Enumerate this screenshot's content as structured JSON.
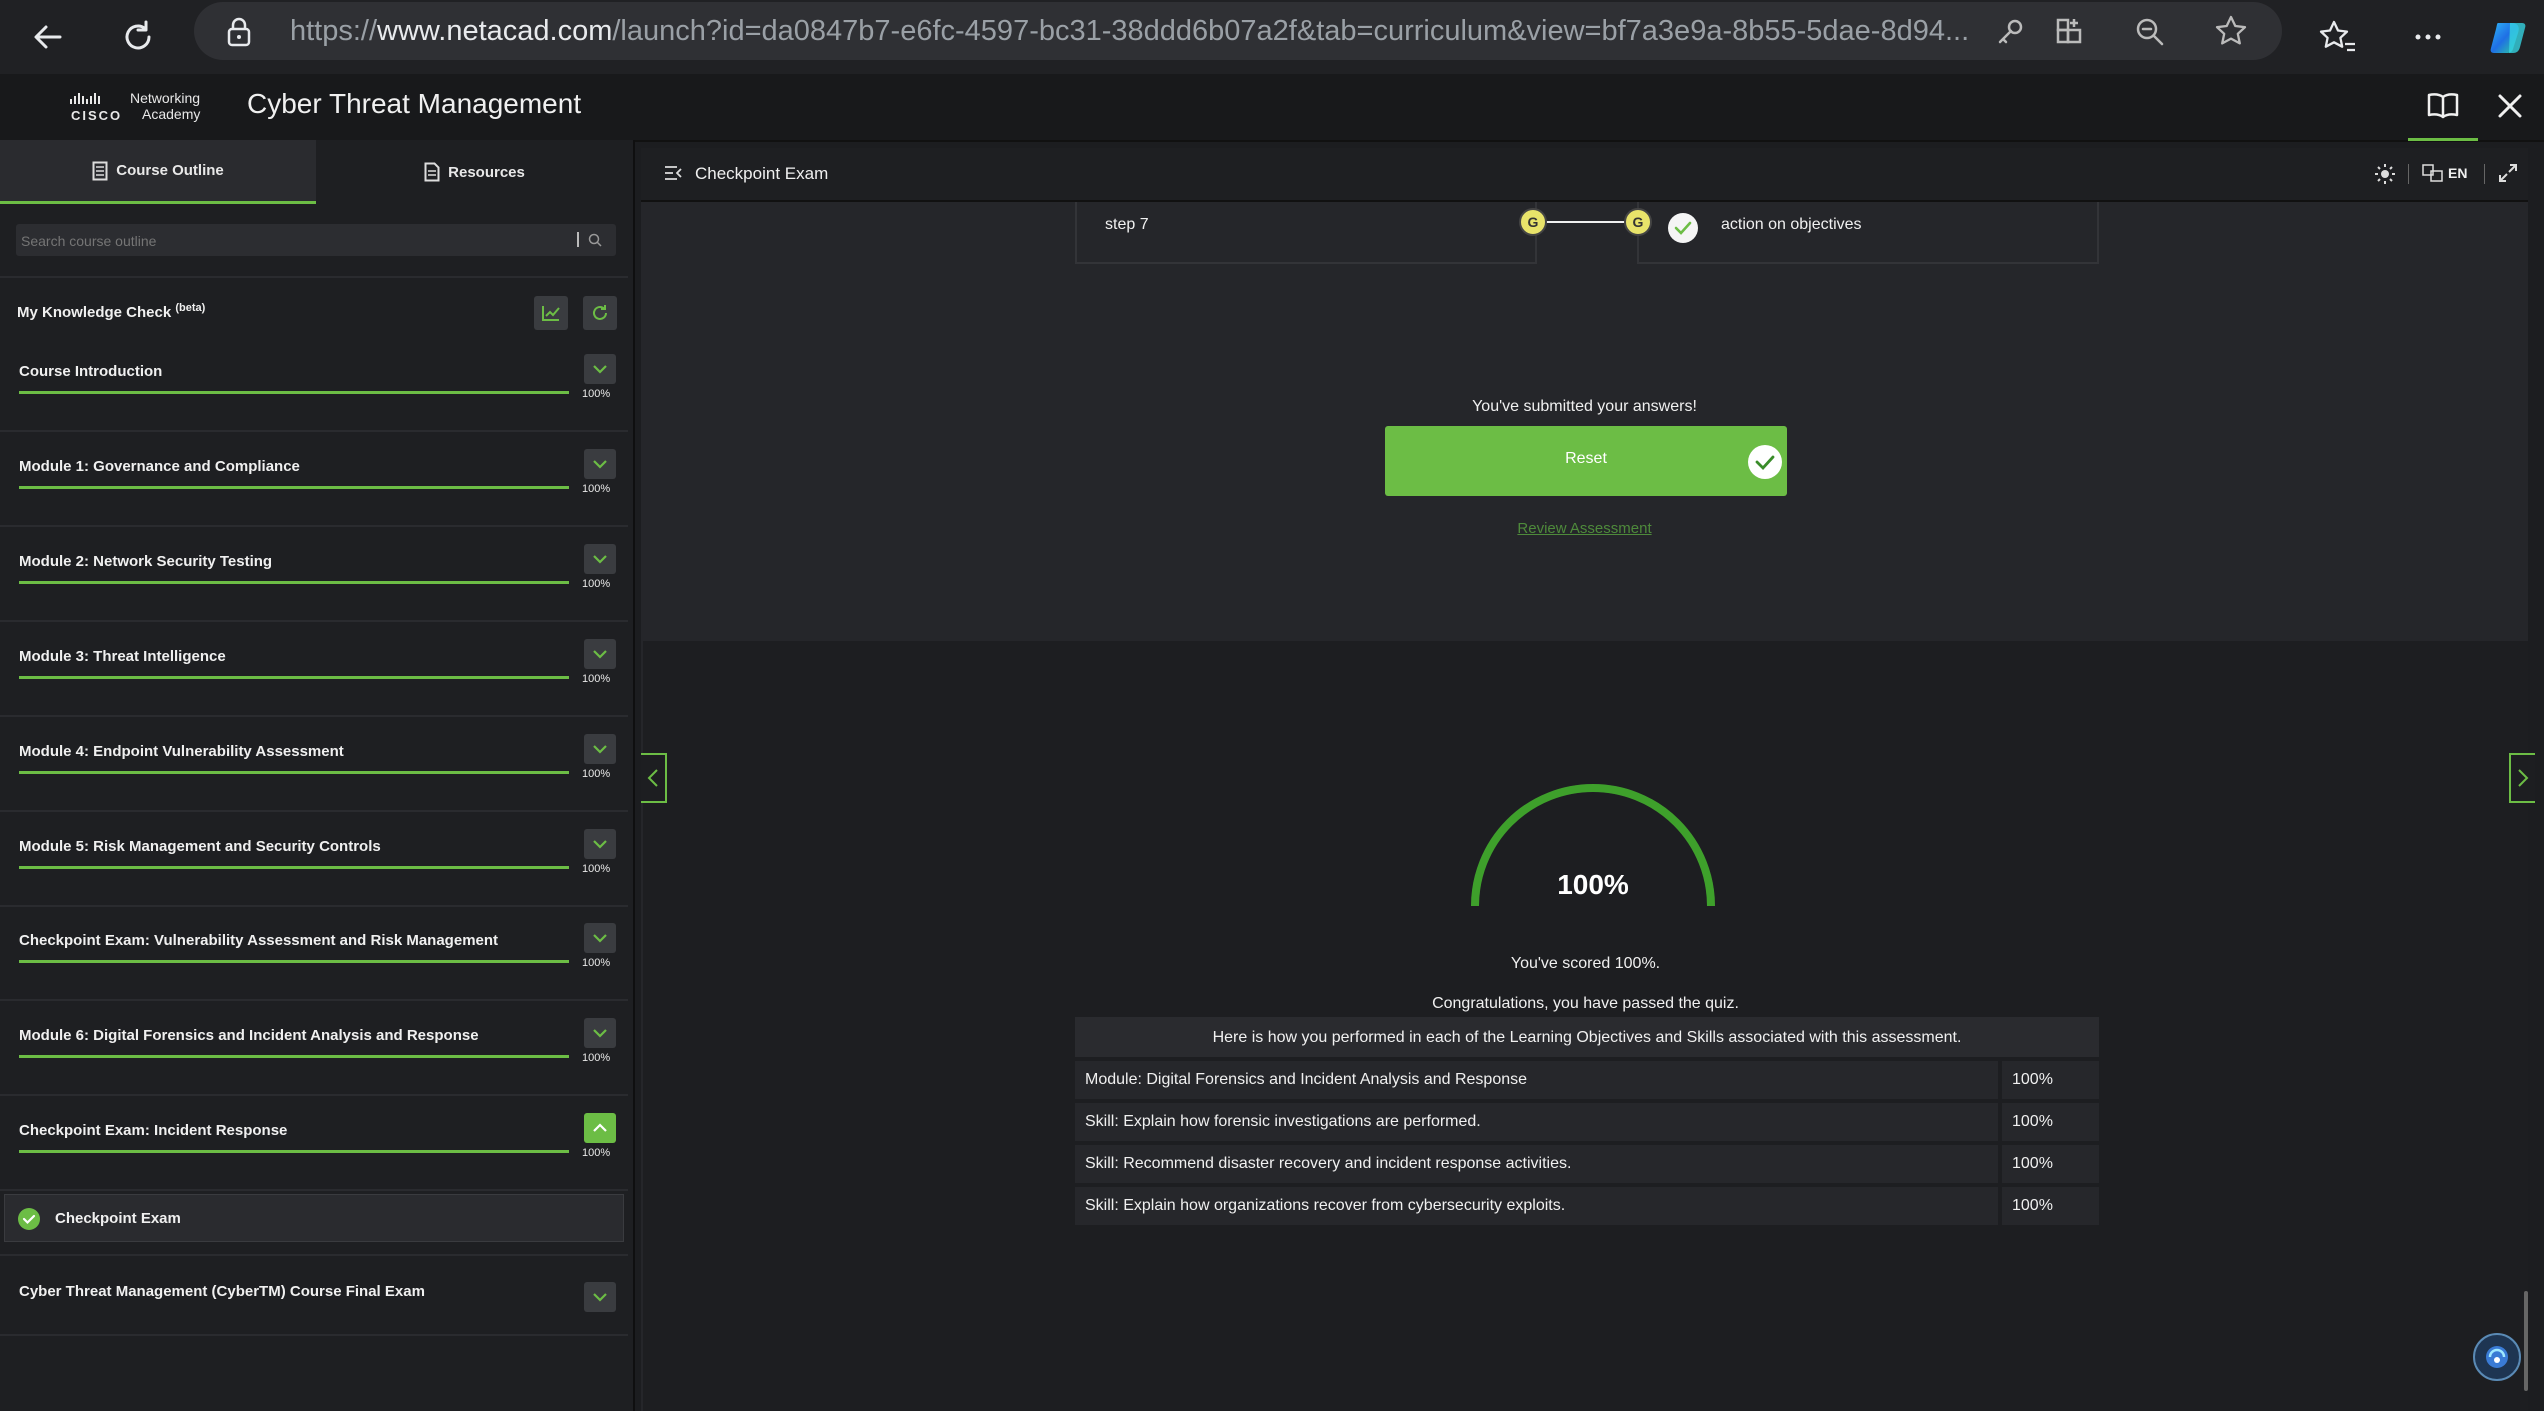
{
  "browser": {
    "url_prefix": "https://",
    "url_domain": "www.netacad.com",
    "url_rest": "/launch?id=da0847b7-e6fc-4597-bc31-38ddd6b07a2f&tab=curriculum&view=bf7a3e9a-8b55-5dae-8d94..."
  },
  "header": {
    "logo_line1": "Networking",
    "logo_cisco": "CISCO",
    "logo_line2": "Academy",
    "course_title": "Cyber Threat Management"
  },
  "sidebar": {
    "tabs": [
      {
        "label": "Course Outline",
        "icon": "document-icon",
        "active": true
      },
      {
        "label": "Resources",
        "icon": "page-icon",
        "active": false
      }
    ],
    "search_placeholder": "Search course outline",
    "knowledge_check": {
      "label": "My Knowledge Check",
      "beta": "(beta)"
    },
    "items": [
      {
        "title": "Course Introduction",
        "progress": 100,
        "pct": "100%"
      },
      {
        "title": "Module 1: Governance and Compliance",
        "progress": 100,
        "pct": "100%"
      },
      {
        "title": "Module 2: Network Security Testing",
        "progress": 100,
        "pct": "100%"
      },
      {
        "title": "Module 3: Threat Intelligence",
        "progress": 100,
        "pct": "100%"
      },
      {
        "title": "Module 4: Endpoint Vulnerability Assessment",
        "progress": 100,
        "pct": "100%"
      },
      {
        "title": "Module 5: Risk Management and Security Controls",
        "progress": 100,
        "pct": "100%"
      },
      {
        "title": "Checkpoint Exam: Vulnerability Assessment and Risk Management",
        "progress": 100,
        "pct": "100%"
      },
      {
        "title": "Module 6: Digital Forensics and Incident Analysis and Response",
        "progress": 100,
        "pct": "100%"
      },
      {
        "title": "Checkpoint Exam: Incident Response",
        "progress": 100,
        "pct": "100%",
        "expanded": true
      }
    ],
    "sub_item": {
      "label": "Checkpoint Exam"
    },
    "final_item": {
      "title": "Cyber Threat Management (CyberTM) Course Final Exam"
    }
  },
  "main": {
    "page_title": "Checkpoint Exam",
    "lang": "EN",
    "step_left": "step 7",
    "step_marker": "G",
    "step_right": "action on objectives",
    "submitted_text": "You've submitted your answers!",
    "reset_label": "Reset",
    "review_link": "Review Assessment",
    "score_value": "100%",
    "score_fraction": 1.0,
    "scored_text": "You've scored 100%.",
    "congrats_text": "Congratulations, you have passed the quiz.",
    "table_header": "Here is how you performed in each of the Learning Objectives and Skills associated with this assessment.",
    "table_rows": [
      {
        "label": "Module: Digital Forensics and Incident Analysis and Response",
        "value": "100%"
      },
      {
        "label": "Skill: Explain how forensic investigations are performed.",
        "value": "100%"
      },
      {
        "label": "Skill: Recommend disaster recovery and incident response activities.",
        "value": "100%"
      },
      {
        "label": "Skill: Explain how organizations recover from cybersecurity exploits.",
        "value": "100%"
      }
    ]
  },
  "colors": {
    "accent_green": "#6cbd45",
    "marker_yellow": "#e8e36a",
    "link_green": "#4e8a3b"
  }
}
